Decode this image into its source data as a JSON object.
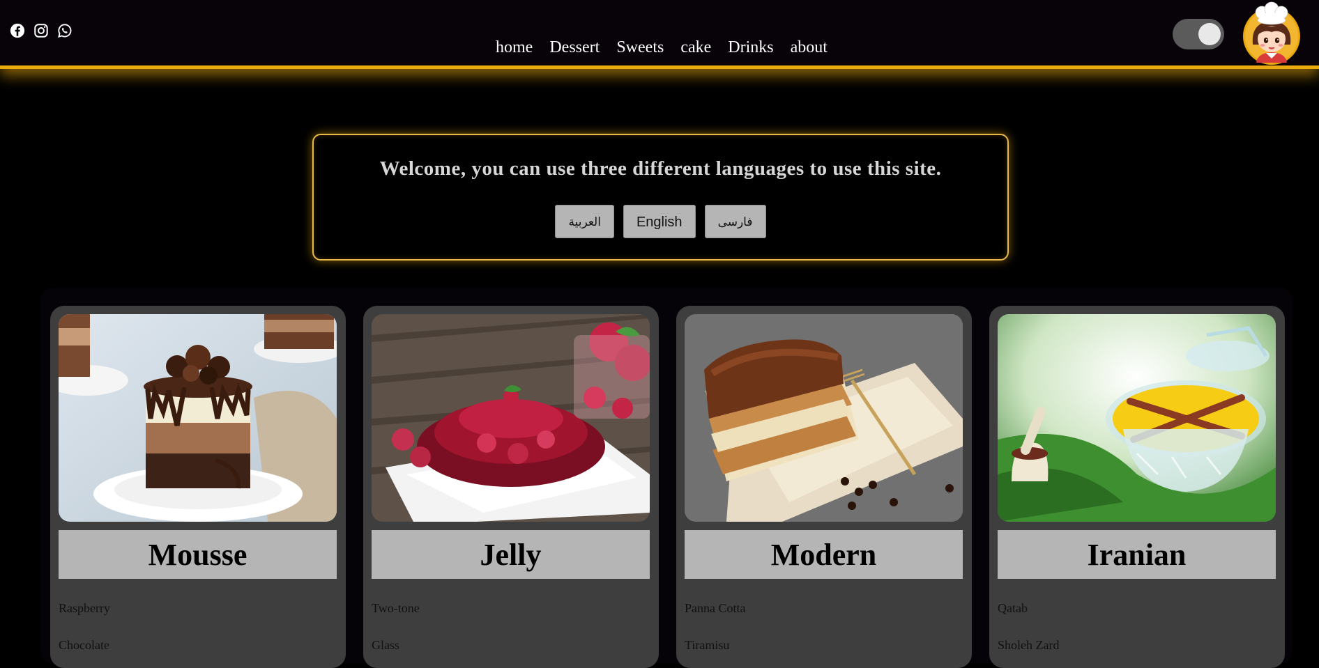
{
  "nav": {
    "items": [
      {
        "label": "home"
      },
      {
        "label": "Dessert"
      },
      {
        "label": "Sweets"
      },
      {
        "label": "cake"
      },
      {
        "label": "Drinks"
      },
      {
        "label": "about"
      }
    ]
  },
  "social": {
    "icons": [
      "facebook-icon",
      "instagram-icon",
      "whatsapp-icon"
    ]
  },
  "theme_toggle": {
    "state": "on"
  },
  "colors": {
    "accent": "#e9a90f",
    "header_bg": "#070309",
    "card_bg": "#3e3e3e",
    "title_box_bg": "#b5b5b5"
  },
  "welcome": {
    "title": "Welcome, you can use three different languages to use this site.",
    "buttons": {
      "arabic": "العربية",
      "english": "English",
      "farsi": "فارسی"
    }
  },
  "cards": [
    {
      "title": "Mousse",
      "items": [
        "Raspberry",
        "Chocolate"
      ]
    },
    {
      "title": "Jelly",
      "items": [
        "Two-tone",
        "Glass"
      ]
    },
    {
      "title": "Modern",
      "items": [
        "Panna Cotta",
        "Tiramisu"
      ]
    },
    {
      "title": "Iranian",
      "items": [
        "Qatab",
        "Sholeh Zard"
      ]
    }
  ]
}
